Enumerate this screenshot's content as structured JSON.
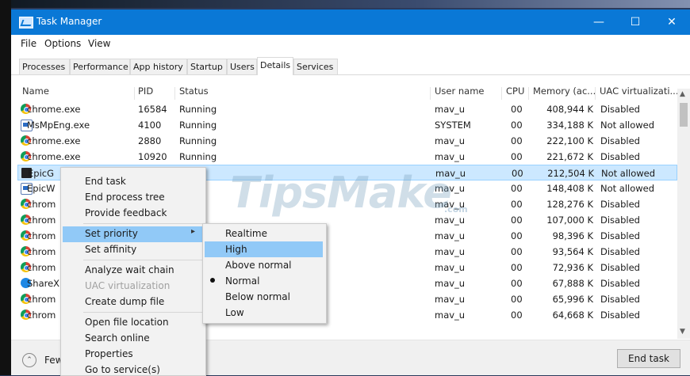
{
  "window": {
    "title": "Task Manager",
    "minimize": "—",
    "maximize": "☐",
    "close": "✕"
  },
  "menu": [
    "File",
    "Options",
    "View"
  ],
  "tabs": [
    "Processes",
    "Performance",
    "App history",
    "Startup",
    "Users",
    "Details",
    "Services"
  ],
  "active_tab": "Details",
  "columns": {
    "name": "Name",
    "pid": "PID",
    "status": "Status",
    "user": "User name",
    "cpu": "CPU",
    "memory": "Memory (ac...",
    "uac": "UAC virtualizati..."
  },
  "rows": [
    {
      "icon": "chrome-icon",
      "name": "chrome.exe",
      "pid": "16584",
      "status": "Running",
      "user": "mav_u",
      "cpu": "00",
      "memory": "408,944 K",
      "uac": "Disabled"
    },
    {
      "icon": "app-window-icon",
      "name": "MsMpEng.exe",
      "pid": "4100",
      "status": "Running",
      "user": "SYSTEM",
      "cpu": "00",
      "memory": "334,188 K",
      "uac": "Not allowed"
    },
    {
      "icon": "chrome-icon",
      "name": "chrome.exe",
      "pid": "2880",
      "status": "Running",
      "user": "mav_u",
      "cpu": "00",
      "memory": "222,100 K",
      "uac": "Disabled"
    },
    {
      "icon": "chrome-icon",
      "name": "chrome.exe",
      "pid": "10920",
      "status": "Running",
      "user": "mav_u",
      "cpu": "00",
      "memory": "221,672 K",
      "uac": "Disabled"
    },
    {
      "icon": "epic-games-icon",
      "name": "EpicG",
      "pid": "",
      "status": "ning",
      "user": "mav_u",
      "cpu": "00",
      "memory": "212,504 K",
      "uac": "Not allowed"
    },
    {
      "icon": "app-window-icon",
      "name": "EpicW",
      "pid": "",
      "status": "ng",
      "user": "mav_u",
      "cpu": "00",
      "memory": "148,408 K",
      "uac": "Not allowed"
    },
    {
      "icon": "chrome-icon",
      "name": "chrom",
      "pid": "",
      "status": "ng",
      "user": "mav_u",
      "cpu": "00",
      "memory": "128,276 K",
      "uac": "Disabled"
    },
    {
      "icon": "chrome-icon",
      "name": "chrom",
      "pid": "",
      "status": "ng",
      "user": "mav_u",
      "cpu": "00",
      "memory": "107,000 K",
      "uac": "Disabled"
    },
    {
      "icon": "chrome-icon",
      "name": "chrom",
      "pid": "",
      "status": "",
      "user": "mav_u",
      "cpu": "00",
      "memory": "98,396 K",
      "uac": "Disabled"
    },
    {
      "icon": "chrome-icon",
      "name": "chrom",
      "pid": "",
      "status": "",
      "user": "mav_u",
      "cpu": "00",
      "memory": "93,564 K",
      "uac": "Disabled"
    },
    {
      "icon": "chrome-icon",
      "name": "chrom",
      "pid": "",
      "status": "",
      "user": "mav_u",
      "cpu": "00",
      "memory": "72,936 K",
      "uac": "Disabled"
    },
    {
      "icon": "sharex-icon",
      "name": "ShareX",
      "pid": "",
      "status": "",
      "user": "mav_u",
      "cpu": "00",
      "memory": "67,888 K",
      "uac": "Disabled"
    },
    {
      "icon": "chrome-icon",
      "name": "chrom",
      "pid": "",
      "status": "",
      "user": "mav_u",
      "cpu": "00",
      "memory": "65,996 K",
      "uac": "Disabled"
    },
    {
      "icon": "chrome-icon",
      "name": "chrom",
      "pid": "",
      "status": "",
      "user": "mav_u",
      "cpu": "00",
      "memory": "64,668 K",
      "uac": "Disabled"
    }
  ],
  "context_menu": {
    "end_task": "End task",
    "end_process_tree": "End process tree",
    "provide_feedback": "Provide feedback",
    "set_priority": "Set priority",
    "set_affinity": "Set affinity",
    "analyze_wait_chain": "Analyze wait chain",
    "uac_virtualization": "UAC virtualization",
    "create_dump_file": "Create dump file",
    "open_file_location": "Open file location",
    "search_online": "Search online",
    "properties": "Properties",
    "go_to_service": "Go to service(s)"
  },
  "priority_menu": {
    "realtime": "Realtime",
    "high": "High",
    "above_normal": "Above normal",
    "normal": "Normal",
    "below_normal": "Below normal",
    "low": "Low",
    "checked": "Normal",
    "highlighted": "High"
  },
  "footer": {
    "fewer_details": "Few",
    "end_task": "End task"
  },
  "watermark": {
    "text": "TipsMake",
    "small": ".com"
  }
}
